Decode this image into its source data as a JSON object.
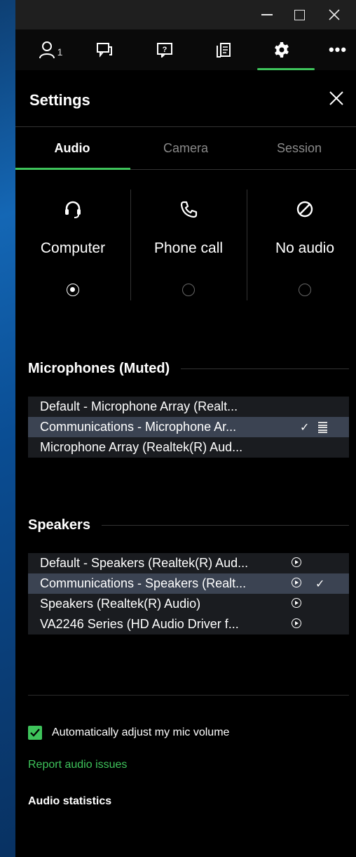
{
  "window": {
    "min_icon": "minimize-icon",
    "max_icon": "maximize-icon",
    "close_icon": "close-icon"
  },
  "toolbar": {
    "people_count": "1",
    "items": [
      "people-icon",
      "chat-icon",
      "question-icon",
      "handout-icon",
      "gear-icon",
      "more-icon"
    ],
    "more_label": "•••"
  },
  "settings": {
    "title": "Settings",
    "tabs": [
      {
        "label": "Audio",
        "active": true
      },
      {
        "label": "Camera",
        "active": false
      },
      {
        "label": "Session",
        "active": false
      }
    ],
    "modes": [
      {
        "label": "Computer",
        "icon": "headset-icon",
        "selected": true
      },
      {
        "label": "Phone call",
        "icon": "phone-icon",
        "selected": false
      },
      {
        "label": "No audio",
        "icon": "no-audio-icon",
        "selected": false
      }
    ]
  },
  "microphones": {
    "title": "Microphones  (Muted)",
    "items": [
      {
        "label": "Default - Microphone Array (Realt...",
        "selected": false
      },
      {
        "label": "Communications - Microphone Ar...",
        "selected": true
      },
      {
        "label": "Microphone Array (Realtek(R) Aud...",
        "selected": false
      }
    ],
    "check": "✓"
  },
  "speakers": {
    "title": "Speakers",
    "items": [
      {
        "label": "Default - Speakers (Realtek(R) Aud...",
        "selected": false
      },
      {
        "label": "Communications - Speakers (Realt...",
        "selected": true
      },
      {
        "label": "Speakers (Realtek(R) Audio)",
        "selected": false
      },
      {
        "label": "VA2246 Series (HD Audio Driver f...",
        "selected": false
      }
    ],
    "check": "✓"
  },
  "auto_adjust": {
    "label": "Automatically adjust my mic volume",
    "checked": true
  },
  "links": {
    "report": "Report audio issues",
    "stats": "Audio statistics"
  },
  "colors": {
    "accent": "#3ec35b",
    "background": "#000000",
    "selected_row": "#3b4352"
  }
}
